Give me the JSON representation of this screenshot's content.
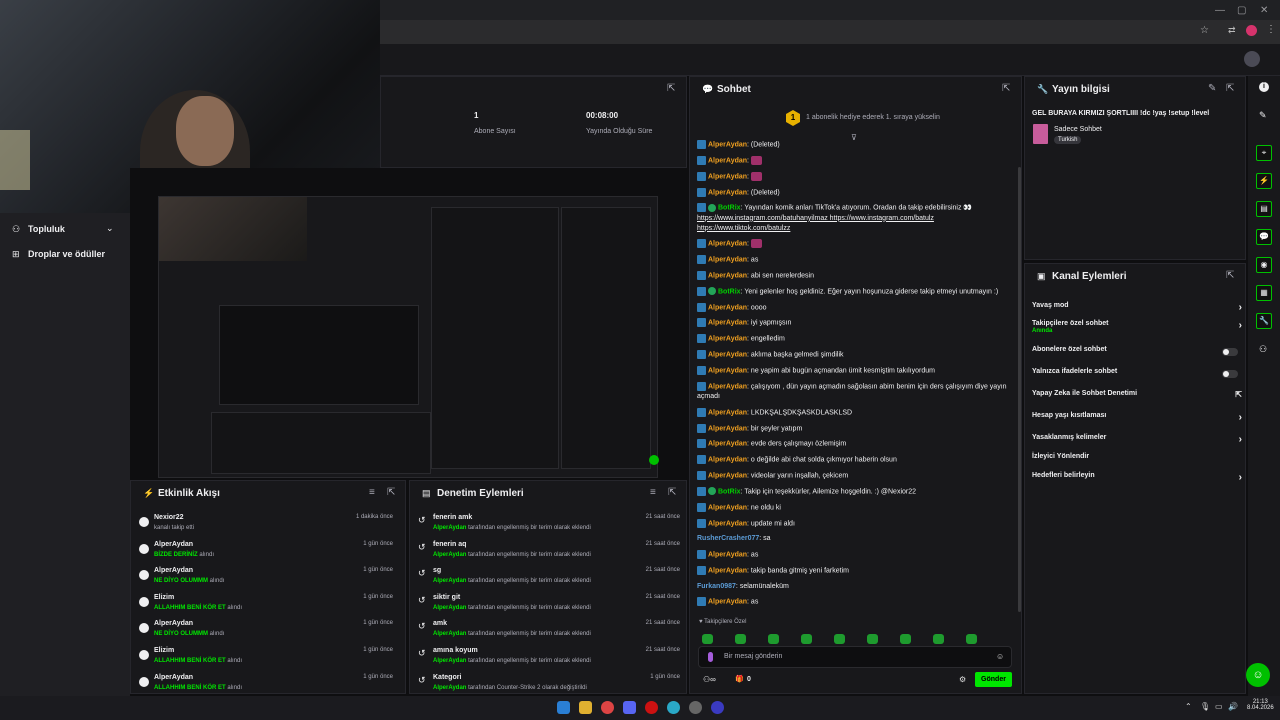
{
  "colors": {
    "accent": "#00e600",
    "bg": "#0e0e10",
    "panel": "#18181b",
    "badge": "#2f7bb4",
    "username": "#f0a020",
    "botname": "#00d000"
  },
  "stats": {
    "followers_value": "1",
    "followers_label": "Abone Sayısı",
    "uptime_value": "00:08:00",
    "uptime_label": "Yayında Olduğu Süre"
  },
  "sidebar": {
    "community": "Topluluk",
    "drops": "Droplar ve ödüller"
  },
  "chat": {
    "title": "Sohbet",
    "hype_banner": "1 abonelik hediye ederek 1. sıraya yükselin",
    "followers_only": "Takipçilere Özel",
    "input_placeholder": "Bir mesaj gönderin",
    "send_label": "Gönder",
    "points": "0",
    "messages": [
      {
        "user": "AlperAydan",
        "text": "(Deleted)",
        "bot": false
      },
      {
        "user": "AlperAydan",
        "text": "",
        "bot": false
      },
      {
        "user": "AlperAydan",
        "text": "",
        "bot": false
      },
      {
        "user": "AlperAydan",
        "text": "(Deleted)",
        "bot": false
      },
      {
        "user": "BotRix",
        "text": "Yayından komik anları TikTok'a atıyorum. Oradan da takip edebilirsiniz 👀",
        "links": "https://www.instagram.com/batuhanyilmaz https://www.instagram.com/batulz https://www.tiktok.com/batulzz",
        "bot": true
      },
      {
        "user": "AlperAydan",
        "text": "",
        "bot": false
      },
      {
        "user": "AlperAydan",
        "text": "as",
        "bot": false
      },
      {
        "user": "AlperAydan",
        "text": "abi sen nerelerdesin",
        "bot": false
      },
      {
        "user": "BotRix",
        "text": "Yeni gelenler hoş geldiniz. Eğer yayın hoşunuza giderse takip etmeyi unutmayın :)",
        "bot": true
      },
      {
        "user": "AlperAydan",
        "text": "oooo",
        "bot": false
      },
      {
        "user": "AlperAydan",
        "text": "iyi yapmışsın",
        "bot": false
      },
      {
        "user": "AlperAydan",
        "text": "engelledim",
        "bot": false
      },
      {
        "user": "AlperAydan",
        "text": "aklıma başka gelmedi şimdilik",
        "bot": false
      },
      {
        "user": "AlperAydan",
        "text": "ne yapim abi bugün açmandan ümit kesmiştim takılıyordum",
        "bot": false
      },
      {
        "user": "AlperAydan",
        "text": "çalışıyom , dün yayın açmadın sağolasın abim benim için ders çalışıyım diye yayın açmadı",
        "bot": false
      },
      {
        "user": "AlperAydan",
        "text": "LKDKŞALŞDKŞASKDLASKLSD",
        "bot": false
      },
      {
        "user": "AlperAydan",
        "text": "bir şeyler yatıpm",
        "bot": false
      },
      {
        "user": "AlperAydan",
        "text": "evde ders çalışmayı özlemişim",
        "bot": false
      },
      {
        "user": "AlperAydan",
        "text": "o değilde abi chat solda çıkmıyor haberin olsun",
        "bot": false
      },
      {
        "user": "AlperAydan",
        "text": "videolar yarın inşallah, çekicem",
        "bot": false
      },
      {
        "user": "BotRix",
        "text": "Takip için teşekkürler, Ailemize hoşgeldin. :) @Nexior22",
        "bot": true
      },
      {
        "user": "AlperAydan",
        "text": "ne oldu ki",
        "bot": false
      },
      {
        "user": "AlperAydan",
        "text": "update mi aldı",
        "bot": false
      },
      {
        "user": "RusherCrasher077",
        "text": "sa",
        "bot": false,
        "plain": true
      },
      {
        "user": "AlperAydan",
        "text": "as",
        "bot": false
      },
      {
        "user": "AlperAydan",
        "text": "takip banda gitmiş yeni farketim",
        "bot": false
      },
      {
        "user": "Furkan0987",
        "text": "selamünaleküm",
        "bot": false,
        "plain": true
      },
      {
        "user": "AlperAydan",
        "text": "as",
        "bot": false
      }
    ]
  },
  "stream_info": {
    "title": "Yayın bilgisi",
    "stream_title": "GEL BURAYA KIRMIZI ŞORTLIIII !dc !yaş !setup !level",
    "category": "Sadece Sohbet",
    "tag": "Turkish"
  },
  "channel_actions": {
    "title": "Kanal Eylemleri",
    "items": [
      {
        "label": "Yavaş mod",
        "type": "chevron"
      },
      {
        "label": "Takipçilere özel sohbet",
        "sub": "Anında",
        "type": "chevron"
      },
      {
        "label": "Abonelere özel sohbet",
        "type": "toggle"
      },
      {
        "label": "Yalnızca ifadelerle sohbet",
        "type": "toggle"
      },
      {
        "label": "Yapay Zeka ile Sohbet Denetimi",
        "type": "external"
      },
      {
        "label": "Hesap yaşı kısıtlaması",
        "type": "chevron"
      },
      {
        "label": "Yasaklanmış kelimeler",
        "type": "chevron"
      },
      {
        "label": "İzleyici Yönlendir",
        "type": "none"
      },
      {
        "label": "Hedefleri belirleyin",
        "type": "chevron"
      }
    ]
  },
  "activity": {
    "title": "Etkinlik Akışı",
    "items": [
      {
        "name": "Nexior22",
        "sub": "kanalı takip etti",
        "highlight": "",
        "suffix": "",
        "time": "1 dakika önce"
      },
      {
        "name": "AlperAydan",
        "sub": "",
        "highlight": "BİZDE DERİNİZ",
        "suffix": " alındı",
        "time": "1 gün önce"
      },
      {
        "name": "AlperAydan",
        "sub": "",
        "highlight": "NE DİYO OLUMMM",
        "suffix": " alındı",
        "time": "1 gün önce"
      },
      {
        "name": "Elizim",
        "sub": "",
        "highlight": "ALLAHHIM BENİ KÖR ET",
        "suffix": " alındı",
        "time": "1 gün önce"
      },
      {
        "name": "AlperAydan",
        "sub": "",
        "highlight": "NE DİYO OLUMMM",
        "suffix": " alındı",
        "time": "1 gün önce"
      },
      {
        "name": "Elizim",
        "sub": "",
        "highlight": "ALLAHHIM BENİ KÖR ET",
        "suffix": " alındı",
        "time": "1 gün önce"
      },
      {
        "name": "AlperAydan",
        "sub": "",
        "highlight": "ALLAHHIM BENİ KÖR ET",
        "suffix": " alındı",
        "time": "1 gün önce"
      }
    ]
  },
  "moderation": {
    "title": "Denetim Eylemleri",
    "items": [
      {
        "term": "fenerin amk",
        "actor": "AlperAydan",
        "desc": " tarafından engellenmiş bir terim olarak eklendi",
        "time": "21 saat önce"
      },
      {
        "term": "fenerin aq",
        "actor": "AlperAydan",
        "desc": " tarafından engellenmiş bir terim olarak eklendi",
        "time": "21 saat önce"
      },
      {
        "term": "sg",
        "actor": "AlperAydan",
        "desc": " tarafından engellenmiş bir terim olarak eklendi",
        "time": "21 saat önce"
      },
      {
        "term": "siktir git",
        "actor": "AlperAydan",
        "desc": " tarafından engellenmiş bir terim olarak eklendi",
        "time": "21 saat önce"
      },
      {
        "term": "amk",
        "actor": "AlperAydan",
        "desc": " tarafından engellenmiş bir terim olarak eklendi",
        "time": "21 saat önce"
      },
      {
        "term": "amına koyum",
        "actor": "AlperAydan",
        "desc": " tarafından engellenmiş bir terim olarak eklendi",
        "time": "21 saat önce"
      },
      {
        "term": "Kategori",
        "actor": "AlperAydan",
        "desc": " tarafından Counter-Strike 2 olarak değiştirildi",
        "time": "1 gün önce"
      }
    ]
  },
  "taskbar": {
    "time": "21:13",
    "date": "8.04.2026"
  }
}
